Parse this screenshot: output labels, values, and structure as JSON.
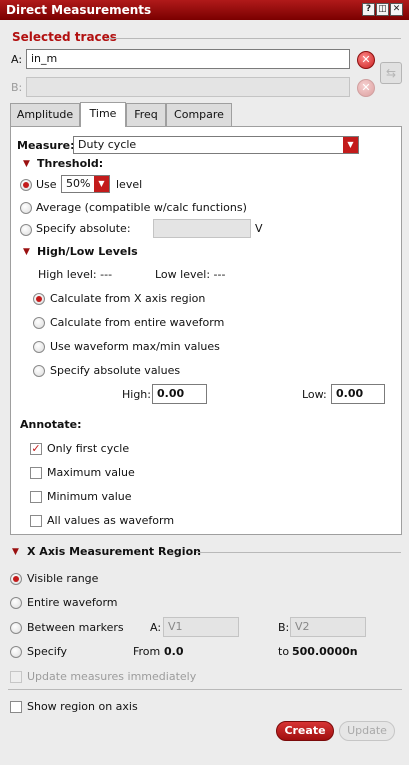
{
  "window": {
    "title": "Direct Measurements",
    "btn_help": "?",
    "btn_restore": "◫",
    "btn_close": "✕"
  },
  "traces": {
    "section_label": "Selected traces",
    "a_label": "A:",
    "a_value": "in_m",
    "b_label": "B:",
    "b_value": ""
  },
  "tabs": [
    "Amplitude",
    "Time",
    "Freq",
    "Compare"
  ],
  "measure": {
    "label": "Measure:",
    "selected": "Duty cycle",
    "threshold": {
      "heading": "Threshold:",
      "use_label": "Use",
      "use_value": "50%",
      "level_label": "level",
      "average_label": "Average (compatible w/calc functions)",
      "specify_label": "Specify absolute:",
      "specify_value": "",
      "specify_unit": "V"
    },
    "levels": {
      "heading": "High/Low Levels",
      "high_level_text": "High level: ---",
      "low_level_text": "Low level: ---",
      "options": [
        "Calculate from X axis region",
        "Calculate from entire waveform",
        "Use waveform max/min values",
        "Specify absolute values"
      ],
      "high_label": "High:",
      "high_value": "0.00",
      "low_label": "Low:",
      "low_value": "0.00"
    },
    "annotate": {
      "heading": "Annotate:",
      "options": [
        "Only first cycle",
        "Maximum value",
        "Minimum value",
        "All values as waveform"
      ]
    }
  },
  "region": {
    "heading": "X Axis Measurement Region",
    "visible_range": "Visible range",
    "entire_waveform": "Entire waveform",
    "between_markers": "Between markers",
    "marker_a_label": "A:",
    "marker_a_value": "V1",
    "marker_b_label": "B:",
    "marker_b_value": "V2",
    "specify_label": "Specify",
    "from_label": "From",
    "from_value": "0.0",
    "to_label": "to",
    "to_value": "500.0000n",
    "update_immediately": "Update measures immediately"
  },
  "show_region": "Show region on axis",
  "buttons": {
    "create": "Create",
    "update": "Update"
  },
  "colors": {
    "accent": "#c31b1b",
    "title_bar": "#9b0d0d"
  },
  "icons": {
    "remove": "remove-trace-icon",
    "swap": "swap-traces-icon",
    "expand": "triangle-down-icon",
    "dropdown": "chevron-down-icon"
  }
}
